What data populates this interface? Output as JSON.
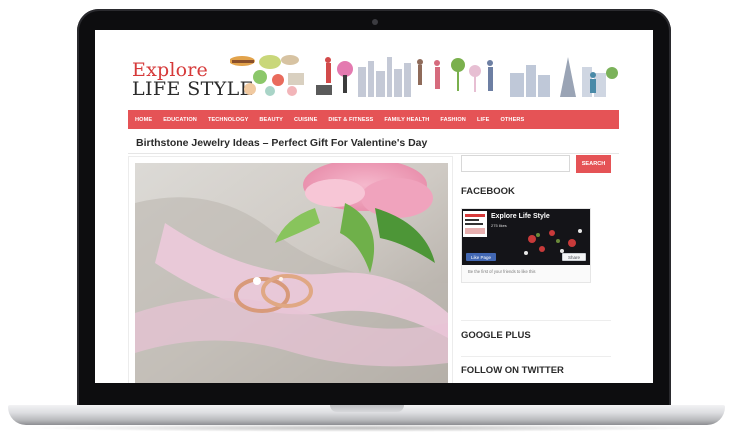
{
  "site": {
    "logo_line1": "Explore",
    "logo_line2": "LIFE STYLE"
  },
  "nav": {
    "items": [
      "HOME",
      "EDUCATION",
      "TECHNOLOGY",
      "BEAUTY",
      "CUISINE",
      "DIET & FITNESS",
      "FAMILY HEALTH",
      "FASHION",
      "LIFE",
      "OTHERS"
    ]
  },
  "post": {
    "title": "Birthstone Jewelry Ideas – Perfect Gift For Valentine's Day"
  },
  "sidebar": {
    "search_button": "SEARCH",
    "facebook": {
      "title": "FACEBOOK",
      "page_name": "Explore Life Style",
      "likes": "275 likes",
      "like_button": "Like Page",
      "share_button": "Share",
      "note": "Be the first of your friends to like this"
    },
    "google_plus_title": "GOOGLE PLUS",
    "twitter_title": "FOLLOW ON TWITTER"
  },
  "colors": {
    "accent": "#e55356",
    "logo_red": "#d63a3a",
    "laptop_bezel": "#0d0d0f"
  }
}
